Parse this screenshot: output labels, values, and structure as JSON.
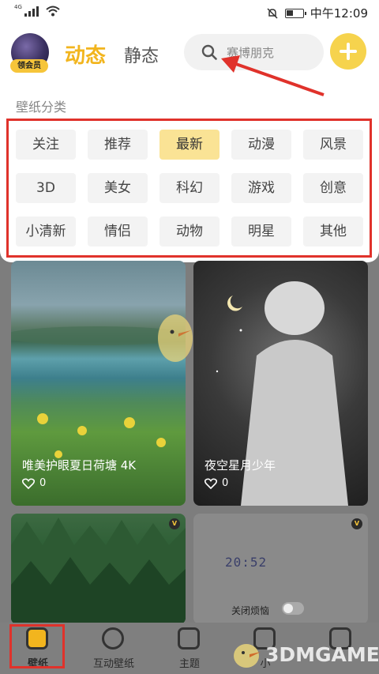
{
  "status_bar": {
    "network": "4G",
    "time": "中午12:09"
  },
  "header": {
    "avatar_badge": "领会员",
    "tabs": [
      {
        "label": "动态",
        "active": true
      },
      {
        "label": "静态",
        "active": false
      }
    ],
    "search_placeholder": "赛博朋克",
    "add_icon": "plus-icon"
  },
  "categories": {
    "title": "壁纸分类",
    "selected": "最新",
    "items": [
      "关注",
      "推荐",
      "最新",
      "动漫",
      "风景",
      "3D",
      "美女",
      "科幻",
      "游戏",
      "创意",
      "小清新",
      "情侣",
      "动物",
      "明星",
      "其他"
    ]
  },
  "wallpapers": [
    {
      "title": "唯美护眼夏日荷塘 4K",
      "likes": "0"
    },
    {
      "title": "夜空星月少年",
      "likes": "0"
    },
    {
      "title": "",
      "likes": "",
      "vip": "V"
    },
    {
      "title": "",
      "likes": "",
      "vip": "V",
      "clock": "20:52",
      "toggle_label": "关闭烦恼"
    }
  ],
  "bottom_nav": [
    {
      "label": "壁纸",
      "icon": "wallpaper-icon",
      "active": true
    },
    {
      "label": "互动壁纸",
      "icon": "interactive-wallpaper-icon",
      "active": false
    },
    {
      "label": "主题",
      "icon": "theme-icon",
      "active": false
    },
    {
      "label": "小",
      "icon": "widget-icon",
      "active": false
    },
    {
      "label": "",
      "icon": "profile-icon",
      "active": false
    }
  ],
  "watermark": "3DMGAME",
  "colors": {
    "accent": "#f2b51e",
    "selected_category_bg": "#fae395",
    "annotation_red": "#e0322b"
  }
}
